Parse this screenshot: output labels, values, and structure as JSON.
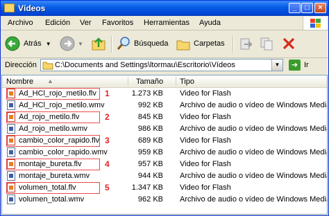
{
  "window": {
    "title": "Vídeos"
  },
  "menu": [
    "Archivo",
    "Edición",
    "Ver",
    "Favoritos",
    "Herramientas",
    "Ayuda"
  ],
  "toolbar": {
    "back_label": "Atrás",
    "search_label": "Búsqueda",
    "folders_label": "Carpetas"
  },
  "address": {
    "label": "Dirección",
    "value": "C:\\Documents and Settings\\ltormau\\Escritorio\\Vídeos",
    "go_label": "Ir"
  },
  "columns": {
    "name": "Nombre",
    "size": "Tamaño",
    "type": "Tipo"
  },
  "files": [
    {
      "name": "Ad_HCl_rojo_metilo.flv",
      "size": "1.273 KB",
      "type": "Video for Flash",
      "kind": "flv",
      "marker": "1"
    },
    {
      "name": "Ad_HCl_rojo_metilo.wmv",
      "size": "992 KB",
      "type": "Archivo de audio o vídeo de Windows Media",
      "kind": "wmv",
      "marker": ""
    },
    {
      "name": "Ad_rojo_metilo.flv",
      "size": "845 KB",
      "type": "Video for Flash",
      "kind": "flv",
      "marker": "2"
    },
    {
      "name": "Ad_rojo_metilo.wmv",
      "size": "986 KB",
      "type": "Archivo de audio o vídeo de Windows Media",
      "kind": "wmv",
      "marker": ""
    },
    {
      "name": "cambio_color_rapido.flv",
      "size": "689 KB",
      "type": "Video for Flash",
      "kind": "flv",
      "marker": "3"
    },
    {
      "name": "cambio_color_rapido.wmv",
      "size": "959 KB",
      "type": "Archivo de audio o vídeo de Windows Media",
      "kind": "wmv",
      "marker": ""
    },
    {
      "name": "montaje_bureta.flv",
      "size": "957 KB",
      "type": "Video for Flash",
      "kind": "flv",
      "marker": "4"
    },
    {
      "name": "montaje_bureta.wmv",
      "size": "944 KB",
      "type": "Archivo de audio o vídeo de Windows Media",
      "kind": "wmv",
      "marker": ""
    },
    {
      "name": "volumen_total.flv",
      "size": "1.347 KB",
      "type": "Video for Flash",
      "kind": "flv",
      "marker": "5"
    },
    {
      "name": "volumen_total.wmv",
      "size": "962 KB",
      "type": "Archivo de audio o vídeo de Windows Media",
      "kind": "wmv",
      "marker": ""
    }
  ],
  "colors": {
    "titlebar": "#0a5ee8",
    "highlight": "#ee4a4a",
    "marker": "#e8202a"
  }
}
